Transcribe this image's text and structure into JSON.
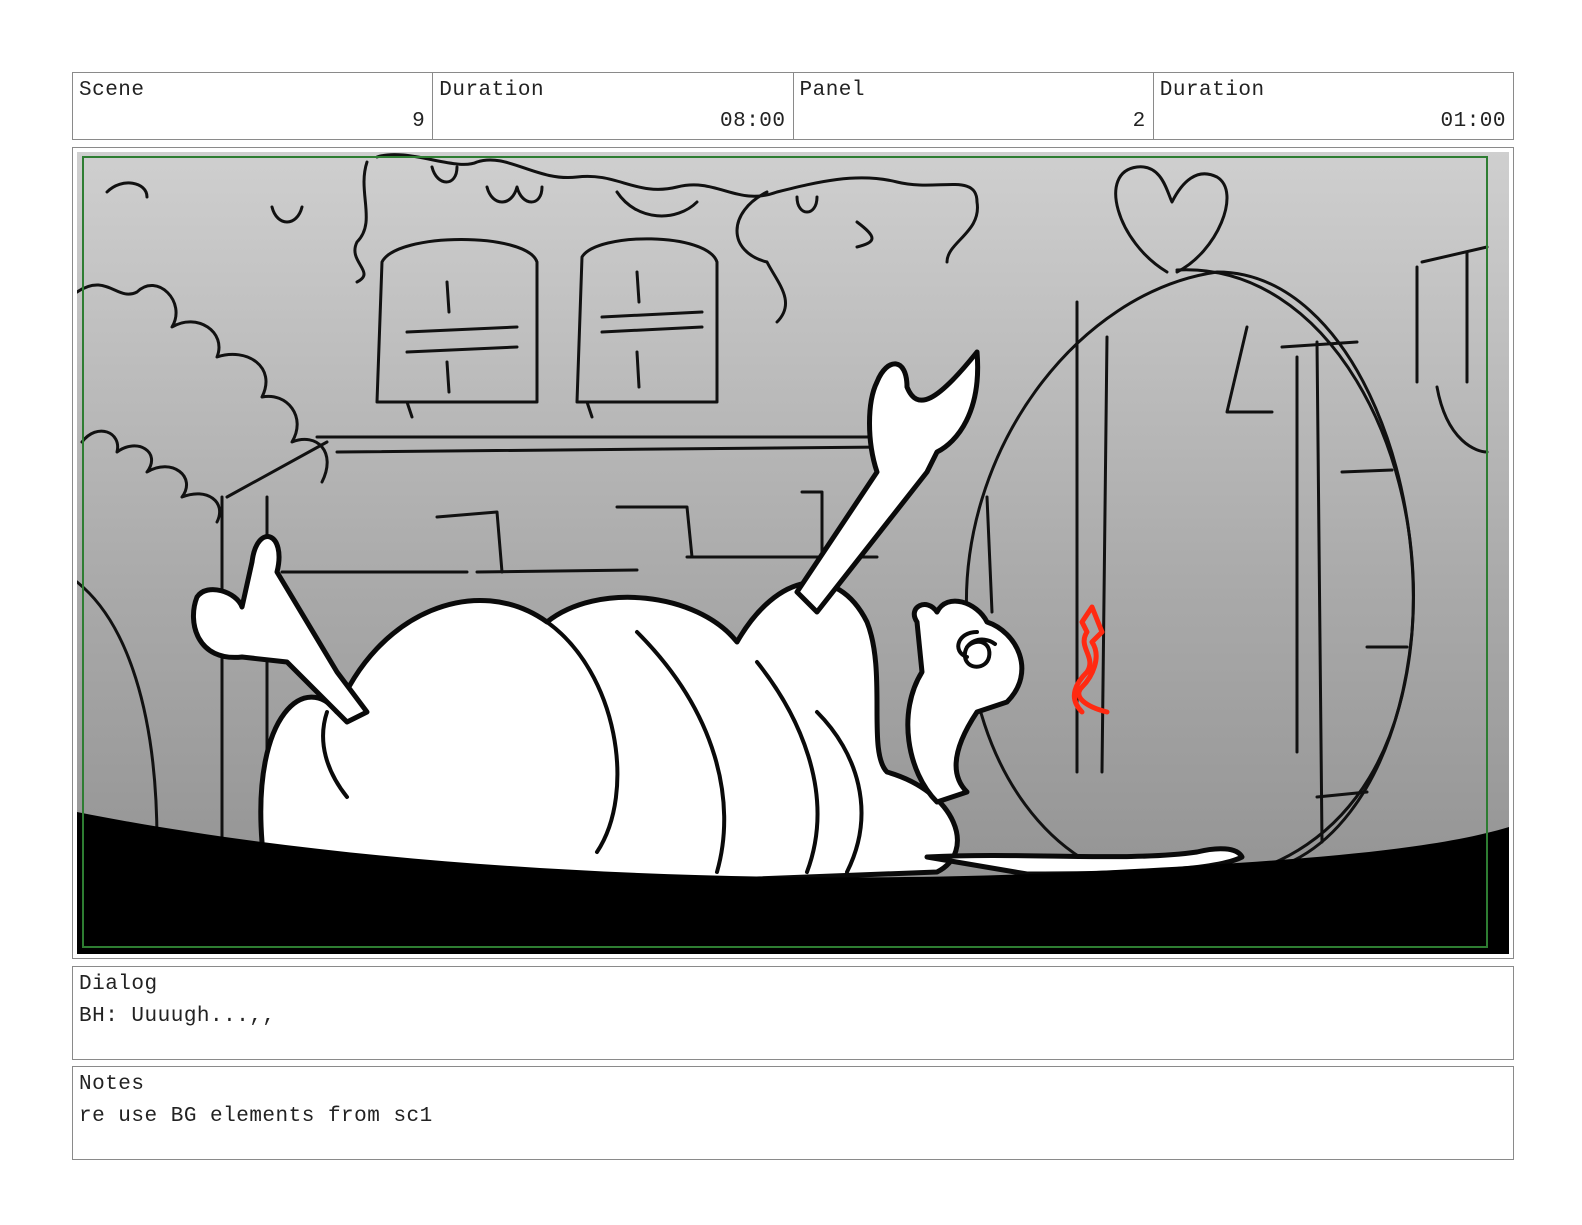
{
  "header": {
    "scene_label": "Scene",
    "scene_value": "9",
    "scene_duration_label": "Duration",
    "scene_duration_value": "08:00",
    "panel_label": "Panel",
    "panel_value": "2",
    "panel_duration_label": "Duration",
    "panel_duration_value": "01:00"
  },
  "panel_image": {
    "icon": "storyboard-sketch",
    "safe_frame_color": "#2e7d32",
    "accent_color": "#ff2a12"
  },
  "dialog": {
    "label": "Dialog",
    "text": "BH: Uuuugh...,,"
  },
  "notes": {
    "label": "Notes",
    "text": "re use BG elements from sc1"
  }
}
